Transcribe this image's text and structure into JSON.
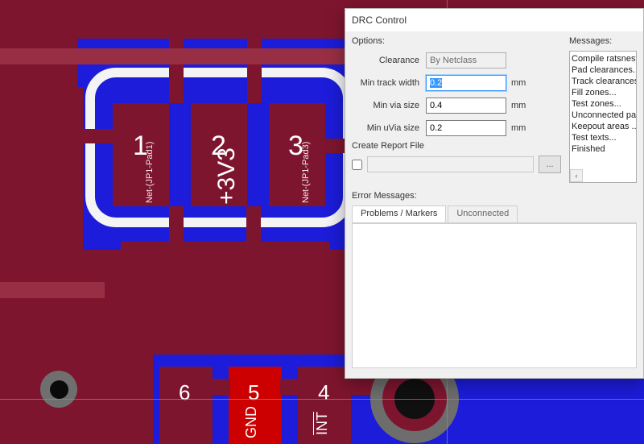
{
  "dialog": {
    "title": "DRC Control",
    "options": {
      "heading": "Options:",
      "clearance_label": "Clearance",
      "clearance_value": "By Netclass",
      "min_track_width_label": "Min track width",
      "min_track_width_value": "0.2",
      "min_via_size_label": "Min via size",
      "min_via_size_value": "0.4",
      "min_uvia_size_label": "Min uVia size",
      "min_uvia_size_value": "0.2",
      "unit": "mm",
      "create_report_label": "Create Report File",
      "report_path": "",
      "browse_label": "..."
    },
    "messages": {
      "heading": "Messages:",
      "items": [
        "Compile ratsnest...",
        "Pad clearances...",
        "Track clearances...",
        "Fill zones...",
        "Test zones...",
        "Unconnected pads...",
        "Keepout areas ...",
        "Test texts...",
        "Finished"
      ]
    },
    "errors": {
      "heading": "Error Messages:",
      "tab_problems": "Problems / Markers",
      "tab_unconnected": "Unconnected"
    }
  },
  "pcb": {
    "top_pads": [
      {
        "num": "1",
        "net": "Net-(JP1-Pad1)"
      },
      {
        "num": "2",
        "net": "+3V3"
      },
      {
        "num": "3",
        "net": "Net-(JP1-Pad3)"
      }
    ],
    "bottom_pads": [
      {
        "num": "6",
        "net": ""
      },
      {
        "num": "5",
        "net": "GND"
      },
      {
        "num": "4",
        "net": "INT",
        "overline": true
      }
    ]
  }
}
